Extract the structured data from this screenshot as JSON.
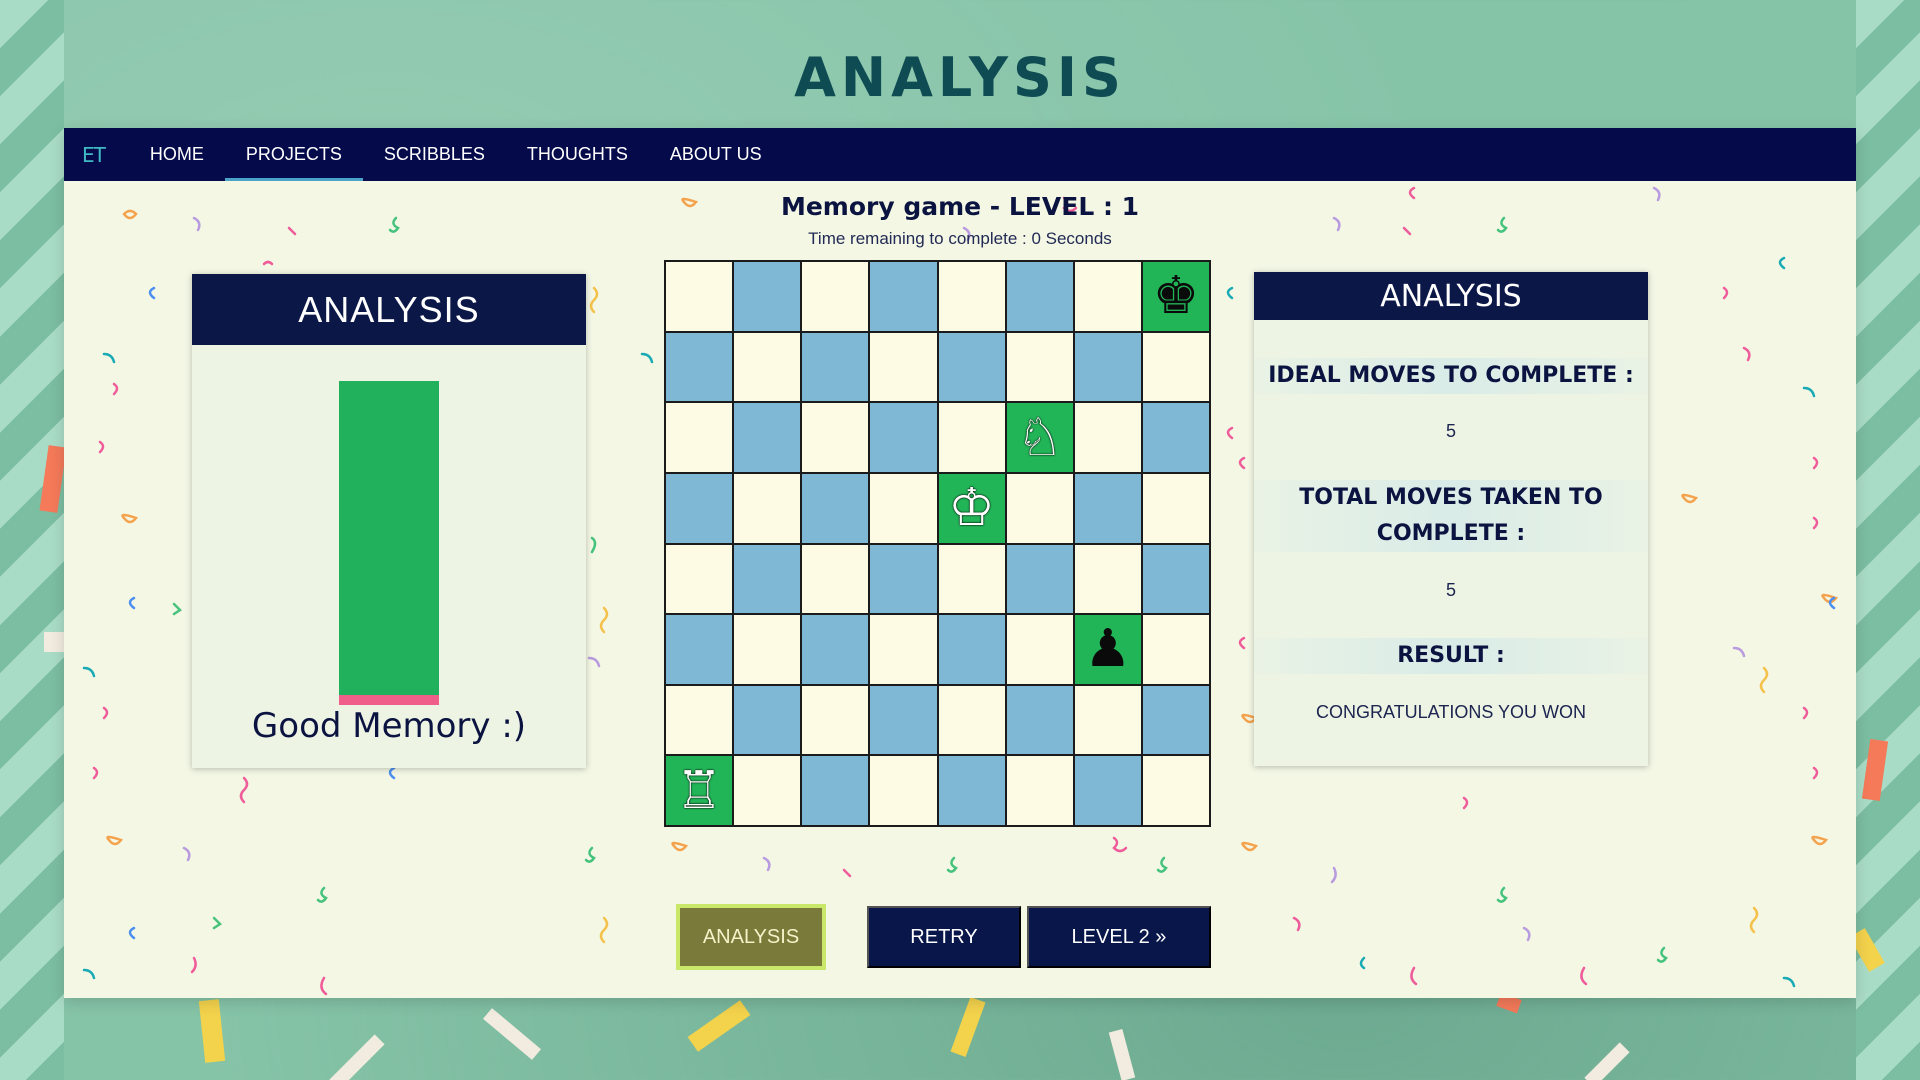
{
  "site": {
    "title": "ANALYSIS"
  },
  "nav": {
    "logo": "ET",
    "items": [
      {
        "label": "HOME",
        "active": false
      },
      {
        "label": "PROJECTS",
        "active": true
      },
      {
        "label": "SCRIBBLES",
        "active": false
      },
      {
        "label": "THOUGHTS",
        "active": false
      },
      {
        "label": "ABOUT US",
        "active": false
      }
    ]
  },
  "game": {
    "heading": "Memory game - LEVEL : 1",
    "timer": "Time remaining to complete : 0 Seconds"
  },
  "left_card": {
    "title": "ANALYSIS",
    "memory_score_fraction": 0.97,
    "memory_label": "Good Memory :)",
    "colors": {
      "fill": "#21b05b",
      "remainder": "#f05f89"
    }
  },
  "board": {
    "size": 8,
    "pieces": [
      {
        "row": 0,
        "col": 7,
        "symbol": "♚",
        "name": "black-king-icon",
        "color": "black"
      },
      {
        "row": 2,
        "col": 5,
        "symbol": "♘",
        "name": "white-knight-icon",
        "color": "white"
      },
      {
        "row": 3,
        "col": 4,
        "symbol": "♔",
        "name": "white-king-icon",
        "color": "white"
      },
      {
        "row": 5,
        "col": 6,
        "symbol": "♟",
        "name": "black-pawn-icon",
        "color": "black"
      },
      {
        "row": 7,
        "col": 0,
        "symbol": "♖",
        "name": "white-rook-icon",
        "color": "white"
      }
    ],
    "colors": {
      "light": "#fdfbe3",
      "dark": "#7fb8d4",
      "highlight": "#22b558"
    }
  },
  "right_card": {
    "title": "ANALYSIS",
    "ideal_moves_label": "IDEAL MOVES TO COMPLETE :",
    "ideal_moves_value": "5",
    "total_moves_label_line1": "TOTAL MOVES TAKEN TO",
    "total_moves_label_line2": "COMPLETE :",
    "total_moves_value": "5",
    "result_label": "RESULT :",
    "result_value": "CONGRATULATIONS YOU WON"
  },
  "buttons": {
    "analysis": "ANALYSIS",
    "retry": "RETRY",
    "next_level": "LEVEL 2 »"
  }
}
